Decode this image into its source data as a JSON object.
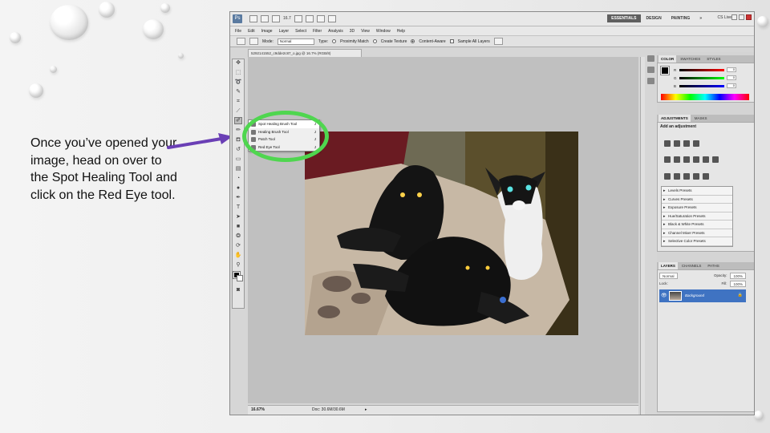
{
  "caption": "Once you’ve opened your image, head on over to the Spot Healing Tool and click on the Red Eye tool.",
  "photoshop": {
    "logo": "Ps",
    "app_bar": {
      "zoom_select": "16.7",
      "workspaces": [
        "ESSENTIALS",
        "DESIGN",
        "PAINTING"
      ],
      "workspace_more": "»",
      "cs_live": "CS Live",
      "colors": {
        "active_workspace_bg": "#5f5f5f"
      }
    },
    "menu": [
      "File",
      "Edit",
      "Image",
      "Layer",
      "Select",
      "Filter",
      "Analysis",
      "3D",
      "View",
      "Window",
      "Help"
    ],
    "options": {
      "mode_label": "Mode:",
      "mode_value": "Normal",
      "type_label": "Type:",
      "type_options": [
        "Proximity Match",
        "Create Texture",
        "Content-Aware"
      ],
      "type_selected": "Content-Aware",
      "sample_all_label": "Sample All Layers"
    },
    "document_tab": "5292141552_c9dde2c87_o.jpg @ 16.7% (RGB/8)",
    "flyout": {
      "items": [
        {
          "label": "Spot Healing Brush Tool",
          "shortcut": "J"
        },
        {
          "label": "Healing Brush Tool",
          "shortcut": "J"
        },
        {
          "label": "Patch Tool",
          "shortcut": "J"
        },
        {
          "label": "Red Eye Tool",
          "shortcut": "J"
        }
      ],
      "highlight_color": "#4fd64f"
    },
    "status": {
      "zoom": "16.67%",
      "doc": "Doc: 30.6M/30.6M"
    },
    "color_panel": {
      "tabs": [
        "COLOR",
        "SWATCHES",
        "STYLES"
      ],
      "channels": [
        {
          "name": "R",
          "value": "0"
        },
        {
          "name": "G",
          "value": "0"
        },
        {
          "name": "B",
          "value": "0"
        }
      ]
    },
    "adjustments_panel": {
      "tabs": [
        "ADJUSTMENTS",
        "MASKS"
      ],
      "heading": "Add an adjustment",
      "presets": [
        "Levels Presets",
        "Curves Presets",
        "Exposure Presets",
        "Hue/Saturation Presets",
        "Black & White Presets",
        "Channel Mixer Presets",
        "Selective Color Presets"
      ]
    },
    "layers_panel": {
      "tabs": [
        "LAYERS",
        "CHANNELS",
        "PATHS"
      ],
      "blend_mode": "Normal",
      "opacity_label": "Opacity:",
      "opacity": "100%",
      "lock_label": "Lock:",
      "fill_label": "Fill:",
      "fill": "100%",
      "layer_name": "Background",
      "colors": {
        "selected_layer": "#3f73c2"
      }
    },
    "arrow_color": "#6a3fb5"
  }
}
